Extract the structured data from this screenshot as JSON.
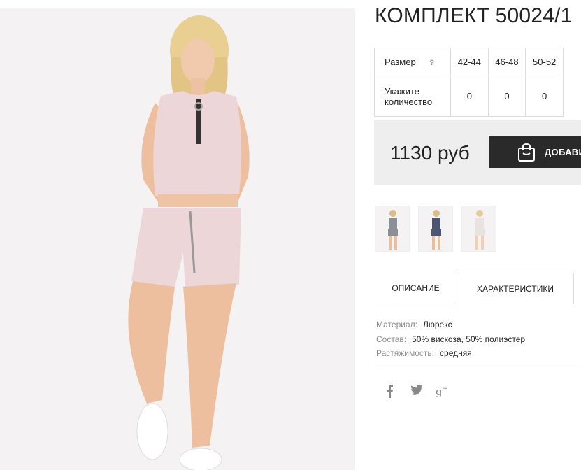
{
  "product": {
    "title": "КОМПЛЕКТ 50024/1",
    "main_image_alt": "photo",
    "sizes": {
      "size_label": "Размер",
      "help_mark": "?",
      "size_values": [
        "42-44",
        "46-48",
        "50-52"
      ],
      "qty_label": "Укажите количество",
      "qty_values": [
        "0",
        "0",
        "0"
      ]
    },
    "price": "1130 руб",
    "add_button_label": "ДОБАВИТЬ",
    "thumbnails": [
      {
        "name": "grey",
        "color": "#8c8f96"
      },
      {
        "name": "navy",
        "color": "#4b5675"
      },
      {
        "name": "white",
        "color": "#e8e3df"
      }
    ]
  },
  "tabs": [
    {
      "label": "ОПИСАНИЕ",
      "active": false
    },
    {
      "label": "ХАРАКТЕРИСТИКИ",
      "active": true
    }
  ],
  "properties": [
    {
      "label": "Материал:",
      "value": "Люрекс"
    },
    {
      "label": "Состав:",
      "value": "50% вискоза, 50% полиэстер"
    },
    {
      "label": "Растяжимость:",
      "value": "средняя"
    }
  ],
  "social": [
    {
      "icon": "facebook-icon",
      "glyph": "f"
    },
    {
      "icon": "twitter-icon",
      "glyph": "🐦︎"
    },
    {
      "icon": "google-plus-icon",
      "glyph": "g+"
    }
  ],
  "colors": {
    "button_bg": "#2a2a2a",
    "price_bg": "#eeeeee",
    "outfit": "#ecd6d8"
  }
}
